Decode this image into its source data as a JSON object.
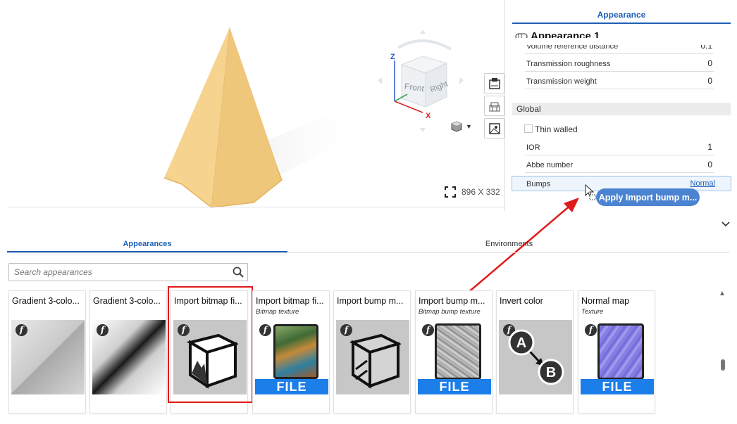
{
  "viewport": {
    "cube_faces": {
      "front": "Front",
      "right": "Right"
    },
    "axes": {
      "z": "Z",
      "x": "X"
    },
    "size_readout": "896 X 332"
  },
  "panel": {
    "tab_label": "Appearance",
    "title": "Appearance 1",
    "rows": [
      {
        "label": "Volume reference distance",
        "value": "0.1"
      },
      {
        "label": "Transmission roughness",
        "value": "0"
      },
      {
        "label": "Transmission weight",
        "value": "0"
      }
    ],
    "section_global": "Global",
    "thin_walled_label": "Thin walled",
    "global_rows": [
      {
        "label": "IOR",
        "value": "1"
      },
      {
        "label": "Abbe number",
        "value": "0"
      }
    ],
    "bumps": {
      "label": "Bumps",
      "value": "Normal"
    },
    "apply_button": "Apply Import bump m..."
  },
  "library": {
    "tabs": [
      "Appearances",
      "Environments"
    ],
    "search_placeholder": "Search appearances",
    "cards": [
      {
        "title": "Gradient 3-colo...",
        "subtitle": ""
      },
      {
        "title": "Gradient 3-colo...",
        "subtitle": ""
      },
      {
        "title": "Import bitmap fi...",
        "subtitle": ""
      },
      {
        "title": "Import bitmap fi...",
        "subtitle": "Bitmap texture",
        "file": "FILE"
      },
      {
        "title": "Import bump m...",
        "subtitle": ""
      },
      {
        "title": "Import bump m...",
        "subtitle": "Bitmap bump texture",
        "file": "FILE"
      },
      {
        "title": "Invert color",
        "subtitle": "",
        "nodes": [
          "A",
          "B"
        ]
      },
      {
        "title": "Normal map",
        "subtitle": "Texture",
        "file": "FILE"
      }
    ]
  },
  "colors": {
    "accent": "#1f5fb5",
    "selection": "#e01b1b",
    "file_bar": "#1c7ee8",
    "pyramid": "#f2c97a"
  }
}
